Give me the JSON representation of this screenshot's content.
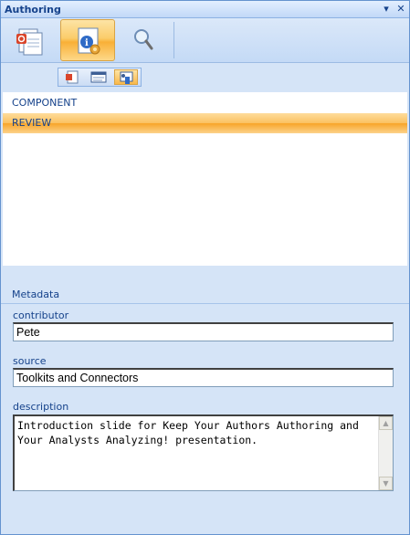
{
  "window": {
    "title": "Authoring",
    "dropdown_glyph": "▾",
    "close_glyph": "✕"
  },
  "toolbar": {
    "buttons": [
      {
        "icon": "slide-document-icon",
        "active": false
      },
      {
        "icon": "info-gear-icon",
        "active": true
      },
      {
        "icon": "magnifier-icon",
        "active": false
      }
    ]
  },
  "subtoolbar": {
    "buttons": [
      {
        "icon": "slide-icon",
        "active": false
      },
      {
        "icon": "text-box-icon",
        "active": false
      },
      {
        "icon": "properties-icon",
        "active": true
      }
    ]
  },
  "list": {
    "items": [
      {
        "label": "COMPONENT",
        "selected": false
      },
      {
        "label": "REVIEW",
        "selected": true
      }
    ]
  },
  "metadata": {
    "heading": "Metadata",
    "contributor_label": "contributor",
    "contributor_value": "Pete",
    "source_label": "source",
    "source_value": "Toolkits and Connectors",
    "description_label": "description",
    "description_value": "Introduction slide for Keep Your Authors Authoring and Your Analysts Analyzing! presentation."
  },
  "colors": {
    "accent": "#15428b",
    "selection": "#f9b037",
    "pane_bg": "#d5e4f7"
  }
}
